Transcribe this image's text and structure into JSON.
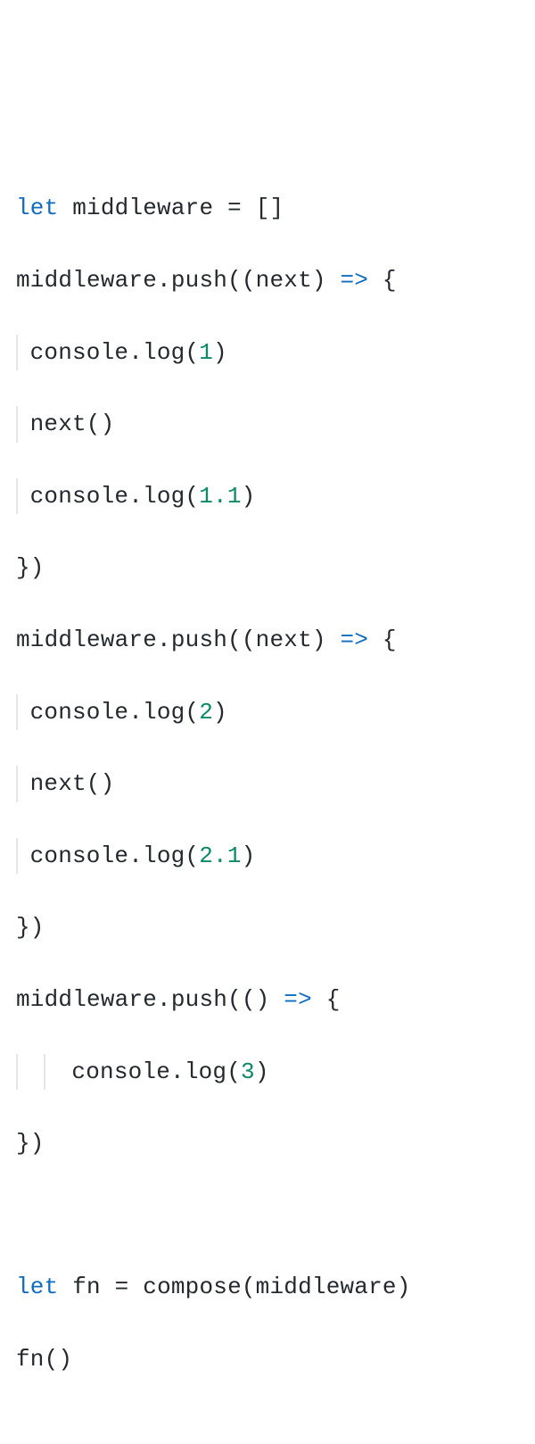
{
  "tokens": {
    "let": "let",
    "middleware": "middleware",
    "eq": " = ",
    "brackets": "[]",
    "push": ".push(",
    "nextParam": "(next) ",
    "emptyParam": "() ",
    "arrow": "=>",
    "openBrace": " {",
    "closeBrace": "})",
    "consoleLog": "console.log(",
    "closeParen": ")",
    "nextCall": "next()",
    "num1": "1",
    "num1_1": "1.1",
    "num2": "2",
    "num2_1": "2.1",
    "num3": "3",
    "fn": "fn",
    "compose": "compose(middleware)",
    "fnCall": "fn()"
  }
}
